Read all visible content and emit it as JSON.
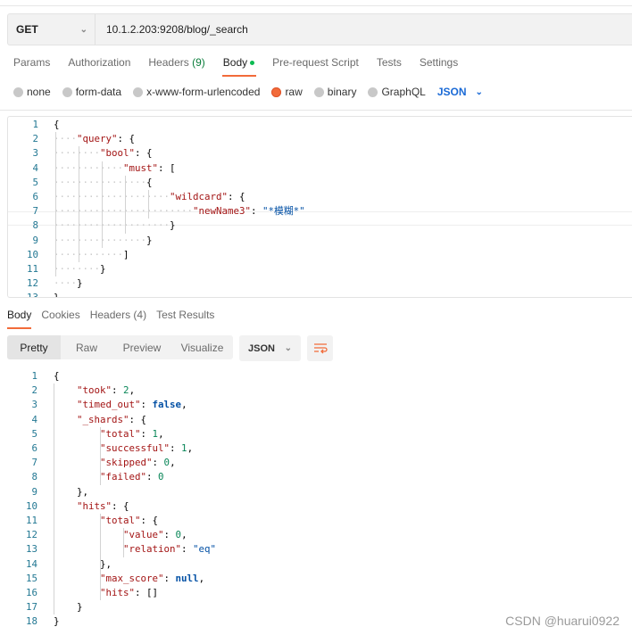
{
  "request": {
    "method": "GET",
    "url": "10.1.2.203:9208/blog/_search"
  },
  "tabs": [
    {
      "label": "Params"
    },
    {
      "label": "Authorization"
    },
    {
      "label": "Headers",
      "count": "(9)"
    },
    {
      "label": "Body",
      "active": true
    },
    {
      "label": "Pre-request Script"
    },
    {
      "label": "Tests"
    },
    {
      "label": "Settings"
    }
  ],
  "body_types": [
    {
      "label": "none"
    },
    {
      "label": "form-data"
    },
    {
      "label": "x-www-form-urlencoded"
    },
    {
      "label": "raw",
      "selected": true
    },
    {
      "label": "binary"
    },
    {
      "label": "GraphQL"
    }
  ],
  "body_format": "JSON",
  "request_body": [
    {
      "i": 0,
      "t": [
        [
          "p",
          "{"
        ]
      ]
    },
    {
      "i": 1,
      "t": [
        [
          "k",
          "\"query\""
        ],
        [
          "p",
          ": "
        ],
        [
          "p",
          "{"
        ]
      ]
    },
    {
      "i": 2,
      "t": [
        [
          "k",
          "\"bool\""
        ],
        [
          "p",
          ": "
        ],
        [
          "p",
          "{"
        ]
      ]
    },
    {
      "i": 3,
      "t": [
        [
          "k",
          "\"must\""
        ],
        [
          "p",
          ": "
        ],
        [
          "p",
          "["
        ]
      ]
    },
    {
      "i": 4,
      "t": [
        [
          "p",
          "{"
        ]
      ]
    },
    {
      "i": 5,
      "t": [
        [
          "k",
          "\"wildcard\""
        ],
        [
          "p",
          ": "
        ],
        [
          "p",
          "{"
        ]
      ]
    },
    {
      "i": 6,
      "t": [
        [
          "k",
          "\"newName3\""
        ],
        [
          "p",
          ": "
        ],
        [
          "s",
          "\"*模糊*\""
        ]
      ]
    },
    {
      "i": 5,
      "t": [
        [
          "p",
          "}"
        ]
      ]
    },
    {
      "i": 4,
      "t": [
        [
          "p",
          "}"
        ]
      ]
    },
    {
      "i": 3,
      "t": [
        [
          "p",
          "]"
        ]
      ]
    },
    {
      "i": 2,
      "t": [
        [
          "p",
          "}"
        ]
      ]
    },
    {
      "i": 1,
      "t": [
        [
          "p",
          "}"
        ]
      ]
    },
    {
      "i": 0,
      "t": [
        [
          "p",
          "}"
        ]
      ]
    }
  ],
  "response_tabs": [
    {
      "label": "Body",
      "active": true
    },
    {
      "label": "Cookies"
    },
    {
      "label": "Headers (4)"
    },
    {
      "label": "Test Results"
    }
  ],
  "view_modes": [
    "Pretty",
    "Raw",
    "Preview",
    "Visualize"
  ],
  "response_format": "JSON",
  "response_body": [
    {
      "i": 0,
      "t": [
        [
          "p",
          "{"
        ]
      ]
    },
    {
      "i": 1,
      "t": [
        [
          "k",
          "\"took\""
        ],
        [
          "p",
          ": "
        ],
        [
          "n",
          "2"
        ],
        [
          "p",
          ","
        ]
      ]
    },
    {
      "i": 1,
      "t": [
        [
          "k",
          "\"timed_out\""
        ],
        [
          "p",
          ": "
        ],
        [
          "b",
          "false"
        ],
        [
          "p",
          ","
        ]
      ]
    },
    {
      "i": 1,
      "t": [
        [
          "k",
          "\"_shards\""
        ],
        [
          "p",
          ": {"
        ]
      ]
    },
    {
      "i": 2,
      "t": [
        [
          "k",
          "\"total\""
        ],
        [
          "p",
          ": "
        ],
        [
          "n",
          "1"
        ],
        [
          "p",
          ","
        ]
      ]
    },
    {
      "i": 2,
      "t": [
        [
          "k",
          "\"successful\""
        ],
        [
          "p",
          ": "
        ],
        [
          "n",
          "1"
        ],
        [
          "p",
          ","
        ]
      ]
    },
    {
      "i": 2,
      "t": [
        [
          "k",
          "\"skipped\""
        ],
        [
          "p",
          ": "
        ],
        [
          "n",
          "0"
        ],
        [
          "p",
          ","
        ]
      ]
    },
    {
      "i": 2,
      "t": [
        [
          "k",
          "\"failed\""
        ],
        [
          "p",
          ": "
        ],
        [
          "n",
          "0"
        ]
      ]
    },
    {
      "i": 1,
      "t": [
        [
          "p",
          "},"
        ]
      ]
    },
    {
      "i": 1,
      "t": [
        [
          "k",
          "\"hits\""
        ],
        [
          "p",
          ": {"
        ]
      ]
    },
    {
      "i": 2,
      "t": [
        [
          "k",
          "\"total\""
        ],
        [
          "p",
          ": {"
        ]
      ]
    },
    {
      "i": 3,
      "t": [
        [
          "k",
          "\"value\""
        ],
        [
          "p",
          ": "
        ],
        [
          "n",
          "0"
        ],
        [
          "p",
          ","
        ]
      ]
    },
    {
      "i": 3,
      "t": [
        [
          "k",
          "\"relation\""
        ],
        [
          "p",
          ": "
        ],
        [
          "s",
          "\"eq\""
        ]
      ]
    },
    {
      "i": 2,
      "t": [
        [
          "p",
          "},"
        ]
      ]
    },
    {
      "i": 2,
      "t": [
        [
          "k",
          "\"max_score\""
        ],
        [
          "p",
          ": "
        ],
        [
          "b",
          "null"
        ],
        [
          "p",
          ","
        ]
      ]
    },
    {
      "i": 2,
      "t": [
        [
          "k",
          "\"hits\""
        ],
        [
          "p",
          ": []"
        ]
      ]
    },
    {
      "i": 1,
      "t": [
        [
          "p",
          "}"
        ]
      ]
    },
    {
      "i": 0,
      "t": [
        [
          "p",
          "}"
        ]
      ]
    }
  ],
  "watermark": "CSDN @huarui0922"
}
